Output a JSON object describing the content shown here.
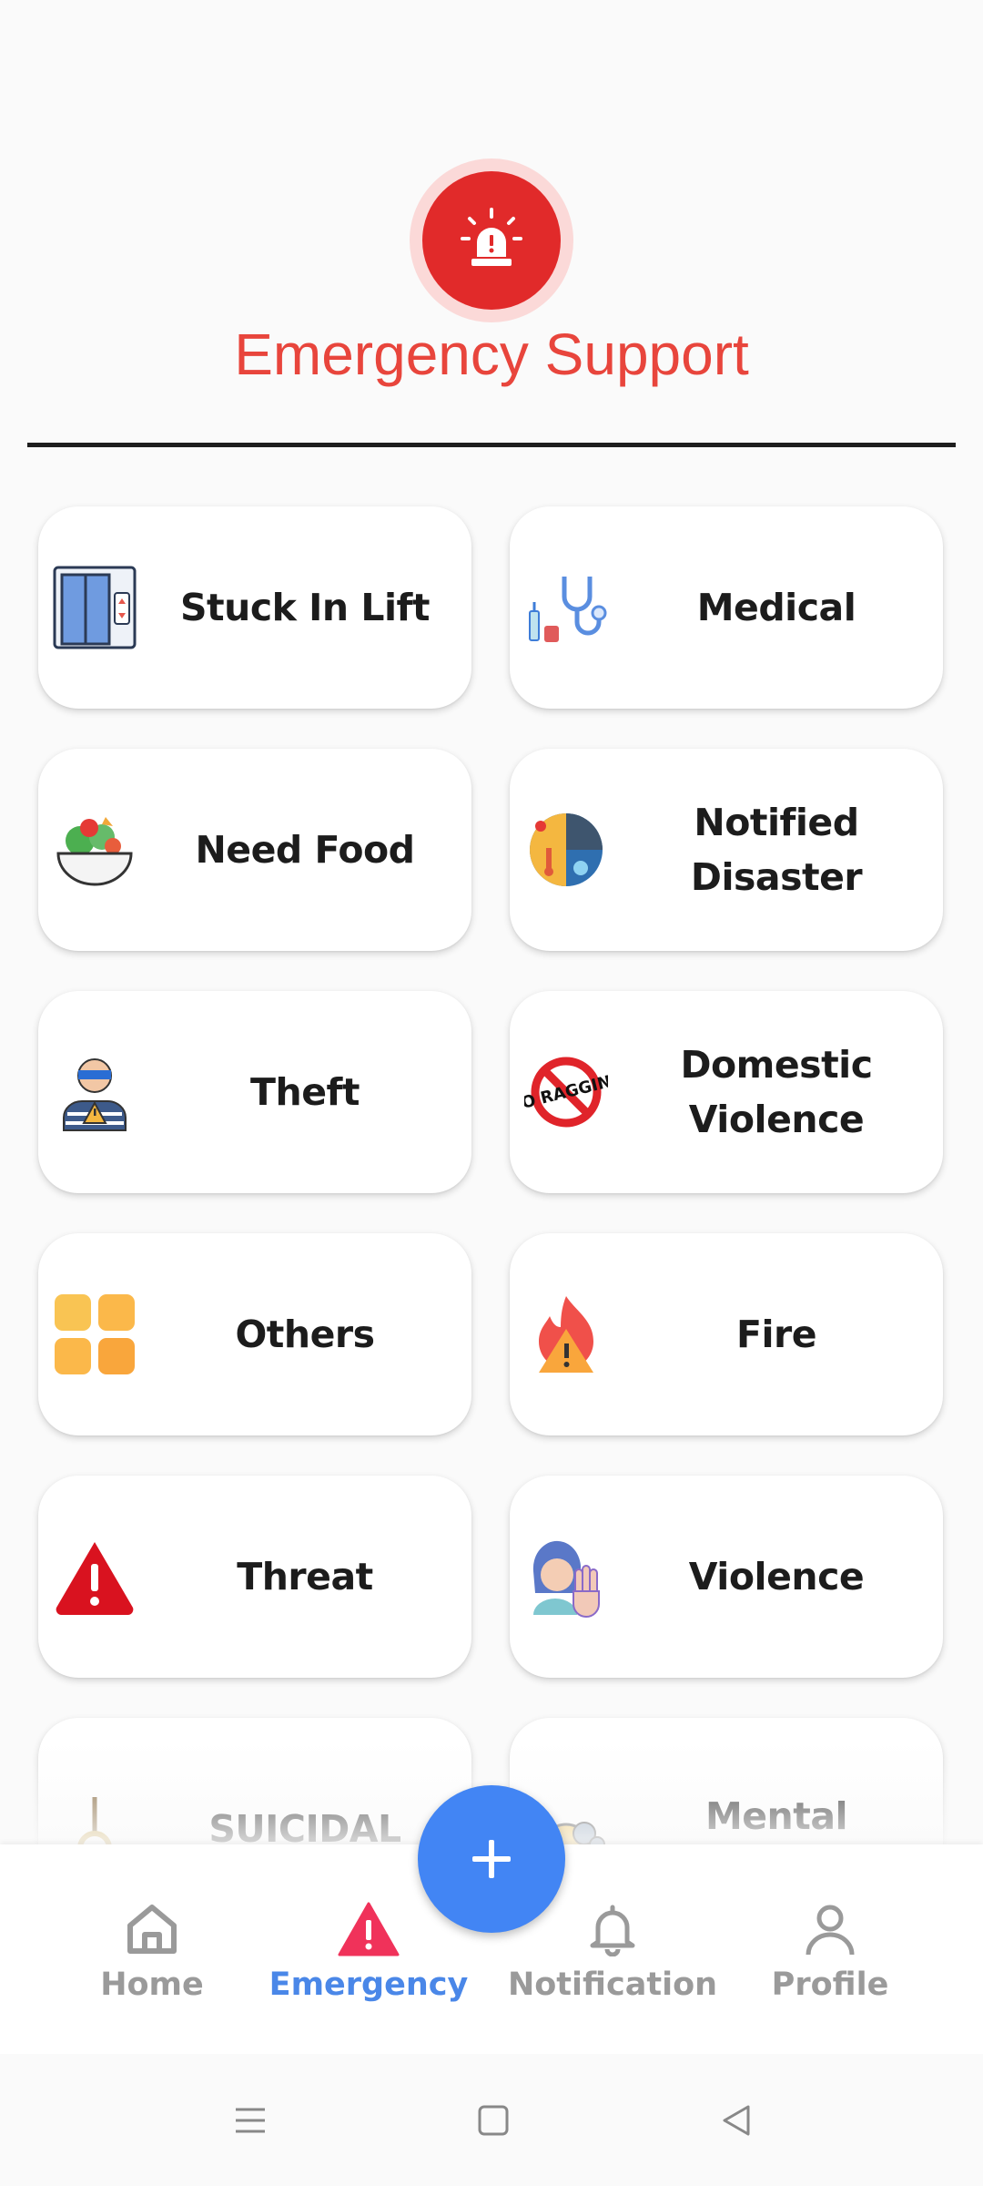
{
  "header": {
    "title": "Emergency Support",
    "icon": "alarm-siren-icon",
    "accent_color": "#e12a2a"
  },
  "categories": [
    {
      "label": "Stuck In Lift",
      "icon": "elevator-icon"
    },
    {
      "label": "Medical",
      "icon": "stethoscope-icon"
    },
    {
      "label": "Need Food",
      "icon": "salad-bowl-icon"
    },
    {
      "label": "Notified Disaster",
      "icon": "disaster-globe-icon"
    },
    {
      "label": "Theft",
      "icon": "thief-icon"
    },
    {
      "label": "Domestic Violence",
      "icon": "no-ragging-icon"
    },
    {
      "label": "Others",
      "icon": "grid-squares-icon"
    },
    {
      "label": "Fire",
      "icon": "fire-warning-icon"
    },
    {
      "label": "Threat",
      "icon": "warning-triangle-icon"
    },
    {
      "label": "Violence",
      "icon": "stop-hand-icon"
    },
    {
      "label": "SUICIDAL",
      "icon": "noose-icon"
    },
    {
      "label": "Mental",
      "icon": "head-gears-icon"
    }
  ],
  "fab": {
    "icon": "plus-icon",
    "color": "#4285f4"
  },
  "bottom_nav": {
    "items": [
      {
        "label": "Home",
        "icon": "home-icon"
      },
      {
        "label": "Emergency",
        "icon": "alert-triangle-icon",
        "active": true
      },
      {
        "label": "Notification",
        "icon": "bell-icon"
      },
      {
        "label": "Profile",
        "icon": "person-icon"
      }
    ],
    "active_color": "#4a87e8",
    "inactive_color": "#9a9a9a"
  },
  "system_nav": {
    "buttons": [
      "menu-icon",
      "home-square-icon",
      "back-triangle-icon"
    ]
  }
}
